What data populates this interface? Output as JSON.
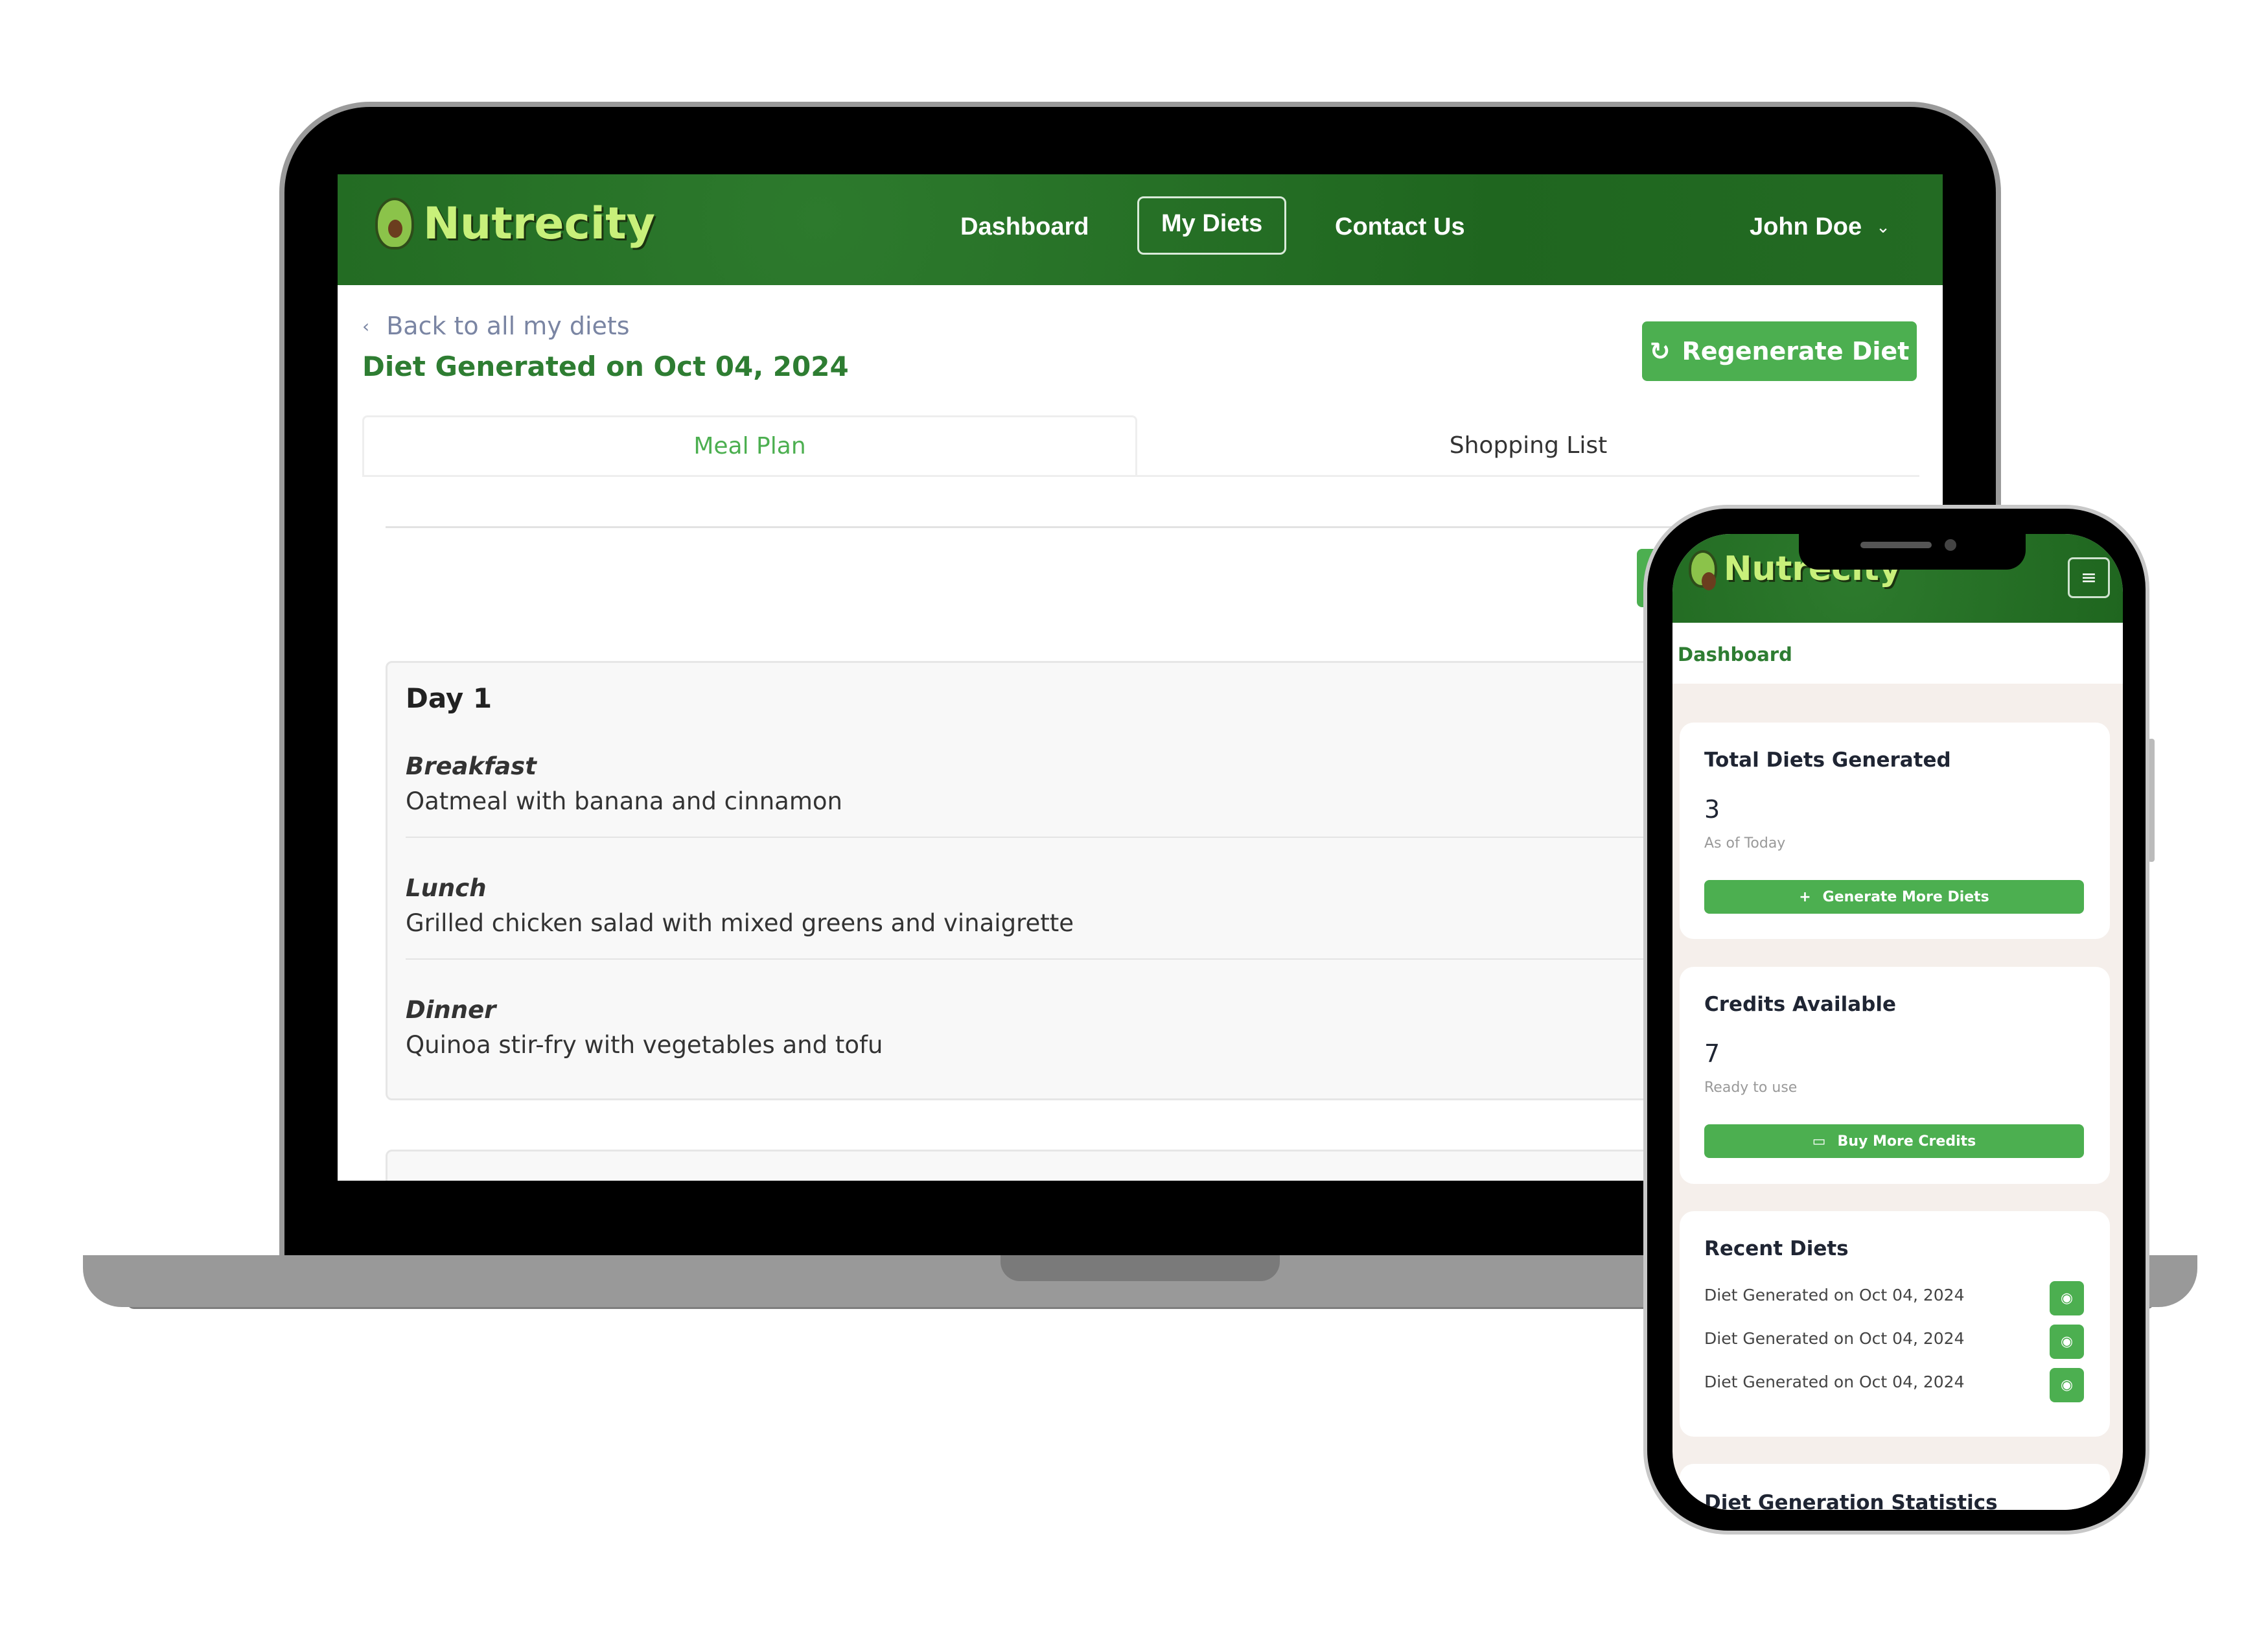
{
  "brand": {
    "name": "Nutrecity"
  },
  "laptop": {
    "nav": {
      "items": [
        {
          "label": "Dashboard"
        },
        {
          "label": "My Diets",
          "active": true
        },
        {
          "label": "Contact Us"
        }
      ],
      "user": "John Doe"
    },
    "back_link": "Back to all my diets",
    "page_title": "Diet Generated on Oct 04, 2024",
    "regenerate_label": "Regenerate Diet",
    "tabs": [
      {
        "label": "Meal Plan",
        "active": true
      },
      {
        "label": "Shopping List"
      }
    ],
    "days": [
      {
        "title": "Day 1",
        "meals": [
          {
            "label": "Breakfast",
            "text": "Oatmeal with banana and cinnamon"
          },
          {
            "label": "Lunch",
            "text": "Grilled chicken salad with mixed greens and vinaigrette"
          },
          {
            "label": "Dinner",
            "text": "Quinoa stir-fry with vegetables and tofu"
          }
        ]
      }
    ]
  },
  "phone": {
    "breadcrumb": "Dashboard",
    "total": {
      "title": "Total Diets Generated",
      "value": "3",
      "sub": "As of Today",
      "button": "Generate More Diets"
    },
    "credits": {
      "title": "Credits Available",
      "value": "7",
      "sub": "Ready to use",
      "button": "Buy More Credits"
    },
    "recent": {
      "title": "Recent Diets",
      "items": [
        "Diet Generated on Oct 04, 2024",
        "Diet Generated on Oct 04, 2024",
        "Diet Generated on Oct 04, 2024"
      ]
    },
    "stats_title": "Diet Generation Statistics"
  },
  "colors": {
    "primary": "#2e7d32",
    "button": "#4caf50",
    "nav": "#236b23"
  }
}
